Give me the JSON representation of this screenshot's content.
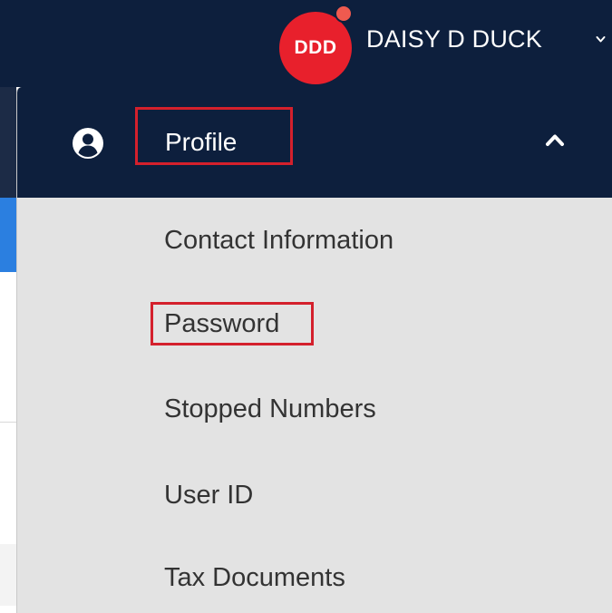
{
  "header": {
    "avatar_initials": "DDD",
    "user_name": "DAISY D DUCK",
    "chevron_icon": "chevron-down-icon"
  },
  "dropdown": {
    "section_label": "Profile",
    "section_icon": "user-circle-icon",
    "collapse_icon": "chevron-up-icon",
    "items": [
      {
        "label": "Contact Information"
      },
      {
        "label": "Password"
      },
      {
        "label": "Stopped Numbers"
      },
      {
        "label": "User ID"
      },
      {
        "label": "Tax Documents"
      }
    ]
  },
  "colors": {
    "navy": "#0d1f3d",
    "avatar_red": "#e8202c",
    "highlight_red": "#d4202c",
    "menu_bg": "#e3e3e3",
    "menu_text": "#333333"
  }
}
